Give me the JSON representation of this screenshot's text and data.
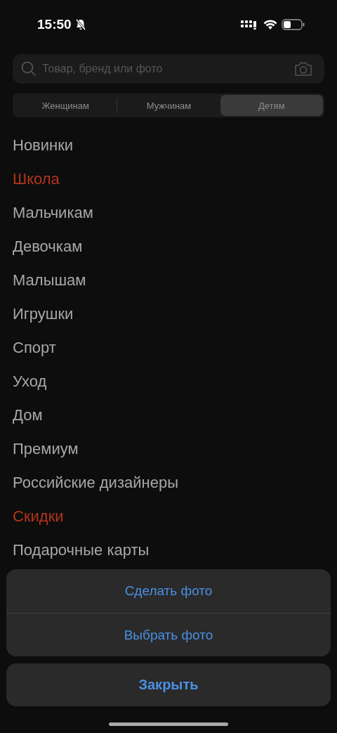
{
  "status_bar": {
    "time": "15:50"
  },
  "search": {
    "placeholder": "Товар, бренд или фото"
  },
  "tabs": [
    {
      "label": "Женщинам",
      "selected": false
    },
    {
      "label": "Мужчинам",
      "selected": false
    },
    {
      "label": "Детям",
      "selected": true
    }
  ],
  "categories": [
    {
      "label": "Новинки",
      "highlighted": false
    },
    {
      "label": "Школа",
      "highlighted": true
    },
    {
      "label": "Мальчикам",
      "highlighted": false
    },
    {
      "label": "Девочкам",
      "highlighted": false
    },
    {
      "label": "Малышам",
      "highlighted": false
    },
    {
      "label": "Игрушки",
      "highlighted": false
    },
    {
      "label": "Спорт",
      "highlighted": false
    },
    {
      "label": "Уход",
      "highlighted": false
    },
    {
      "label": "Дом",
      "highlighted": false
    },
    {
      "label": "Премиум",
      "highlighted": false
    },
    {
      "label": "Российские дизайнеры",
      "highlighted": false
    },
    {
      "label": "Скидки",
      "highlighted": true
    },
    {
      "label": "Подарочные карты",
      "highlighted": false
    }
  ],
  "action_sheet": {
    "actions": [
      "Сделать фото",
      "Выбрать фото"
    ],
    "cancel": "Закрыть"
  }
}
